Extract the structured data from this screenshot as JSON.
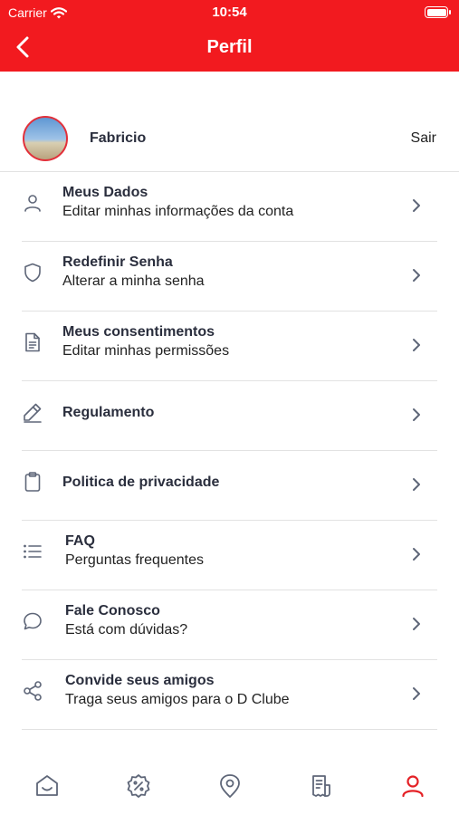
{
  "status": {
    "carrier": "Carrier",
    "time": "10:54"
  },
  "header": {
    "title": "Perfil"
  },
  "profile": {
    "name": "Fabricio",
    "logout": "Sair"
  },
  "menu": [
    {
      "title": "Meus Dados",
      "subtitle": "Editar minhas informações da conta",
      "icon": "user-icon"
    },
    {
      "title": "Redefinir Senha",
      "subtitle": "Alterar a minha senha",
      "icon": "shield-icon"
    },
    {
      "title": "Meus consentimentos",
      "subtitle": "Editar minhas permissões",
      "icon": "document-icon"
    },
    {
      "title": "Regulamento",
      "subtitle": "",
      "icon": "pencil-icon"
    },
    {
      "title": "Politica de privacidade",
      "subtitle": "",
      "icon": "clipboard-icon"
    },
    {
      "title": "FAQ",
      "subtitle": "Perguntas frequentes",
      "icon": "list-icon"
    },
    {
      "title": "Fale Conosco",
      "subtitle": "Está com dúvidas?",
      "icon": "chat-icon"
    },
    {
      "title": "Convide seus amigos",
      "subtitle": "Traga seus amigos para o D Clube",
      "icon": "share-icon"
    }
  ],
  "tabs": [
    {
      "icon": "home-icon",
      "active": false
    },
    {
      "icon": "discount-icon",
      "active": false
    },
    {
      "icon": "location-icon",
      "active": false
    },
    {
      "icon": "receipt-icon",
      "active": false
    },
    {
      "icon": "profile-icon",
      "active": true
    }
  ],
  "colors": {
    "header": "#f21a1f",
    "active_tab": "#e42126",
    "icon": "#5e6678"
  }
}
